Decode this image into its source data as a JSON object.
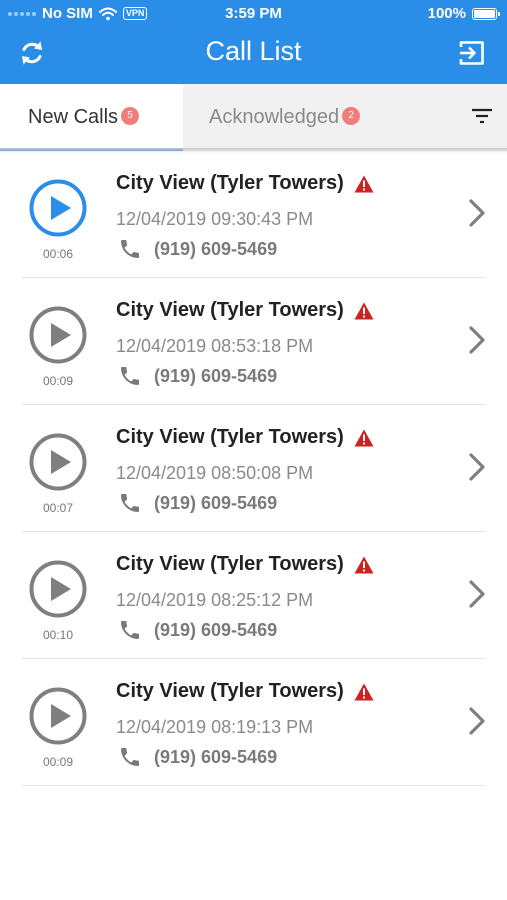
{
  "status_bar": {
    "carrier": "No SIM",
    "vpn": "VPN",
    "time": "3:59 PM",
    "battery": "100%",
    "battery_level": 1.0
  },
  "header": {
    "title": "Call List",
    "left_icon": "refresh-icon",
    "right_icon": "logout-icon",
    "color": "#2a8ee8"
  },
  "tabs": [
    {
      "label": "New Calls",
      "badge": "5",
      "active": true
    },
    {
      "label": "Acknowledged",
      "badge": "2",
      "active": false
    }
  ],
  "filter_icon": "filter-icon",
  "calls": [
    {
      "location": "City View (Tyler Towers)",
      "timestamp": "12/04/2019 09:30:43 PM",
      "phone": "(919) 609-5469",
      "duration": "00:06",
      "playing": true
    },
    {
      "location": "City View (Tyler Towers)",
      "timestamp": "12/04/2019 08:53:18 PM",
      "phone": "(919) 609-5469",
      "duration": "00:09",
      "playing": false
    },
    {
      "location": "City View (Tyler Towers)",
      "timestamp": "12/04/2019 08:50:08 PM",
      "phone": "(919) 609-5469",
      "duration": "00:07",
      "playing": false
    },
    {
      "location": "City View (Tyler Towers)",
      "timestamp": "12/04/2019 08:25:12 PM",
      "phone": "(919) 609-5469",
      "duration": "00:10",
      "playing": false
    },
    {
      "location": "City View (Tyler Towers)",
      "timestamp": "12/04/2019 08:19:13 PM",
      "phone": "(919) 609-5469",
      "duration": "00:09",
      "playing": false
    }
  ],
  "colors": {
    "accent": "#2a8ee8",
    "warning": "#cc2222",
    "badge": "#f07d79",
    "inactive": "#8a8a8a"
  }
}
